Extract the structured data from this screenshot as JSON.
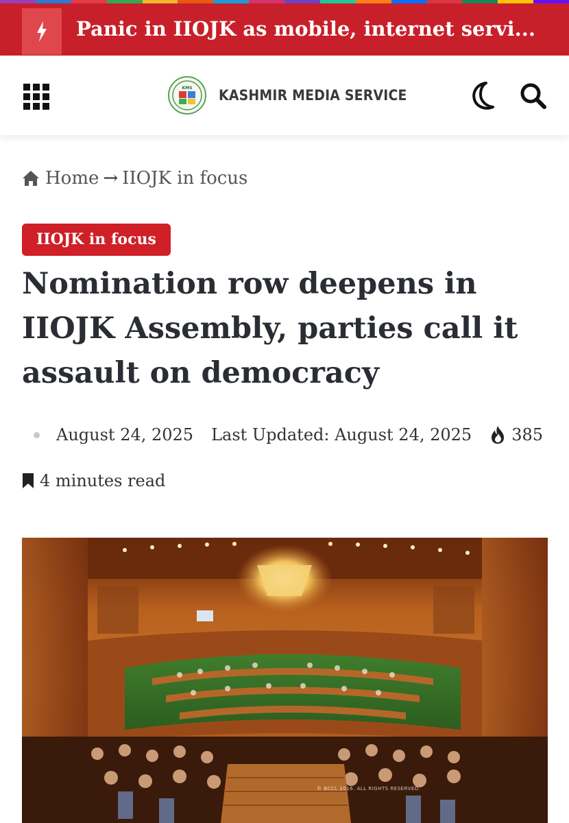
{
  "colors": {
    "brand_red": "#c8202a",
    "badge_red": "#cf1f27",
    "ticker_icon_bg": "#e0474c",
    "rainbow": [
      "#9b3fb5",
      "#2f7ad1",
      "#e63946",
      "#35a852",
      "#f5b72e",
      "#e8580f",
      "#1c9bd7",
      "#d6336c",
      "#6f42c1",
      "#20c997",
      "#fd7e14",
      "#0d6efd",
      "#dc3545",
      "#198754",
      "#ffc107",
      "#6610f2"
    ]
  },
  "ticker": {
    "icon": "lightning-icon",
    "headline": "Panic in IIOJK as mobile, internet servi..."
  },
  "header": {
    "menu_icon": "grid-menu-icon",
    "logo_text": "KASHMIR MEDIA SERVICE",
    "logo_mark_text": "KMS",
    "dark_mode_icon": "moon-icon",
    "search_icon": "search-icon"
  },
  "breadcrumb": {
    "home_icon": "home-icon",
    "home": "Home",
    "separator": "→",
    "current": "IIOJK in focus"
  },
  "article": {
    "category": "IIOJK in focus",
    "title": "Nomination row deepens in IIOJK Assembly, parties call it assault on democracy",
    "date": "August 24, 2025",
    "last_updated": "Last Updated: August 24, 2025",
    "views_icon": "fire-icon",
    "views": "385",
    "read_icon": "bookmark-icon",
    "read_time": "4 minutes read",
    "image_watermark": "© BCCL 2016. ALL RIGHTS RESERVED."
  }
}
